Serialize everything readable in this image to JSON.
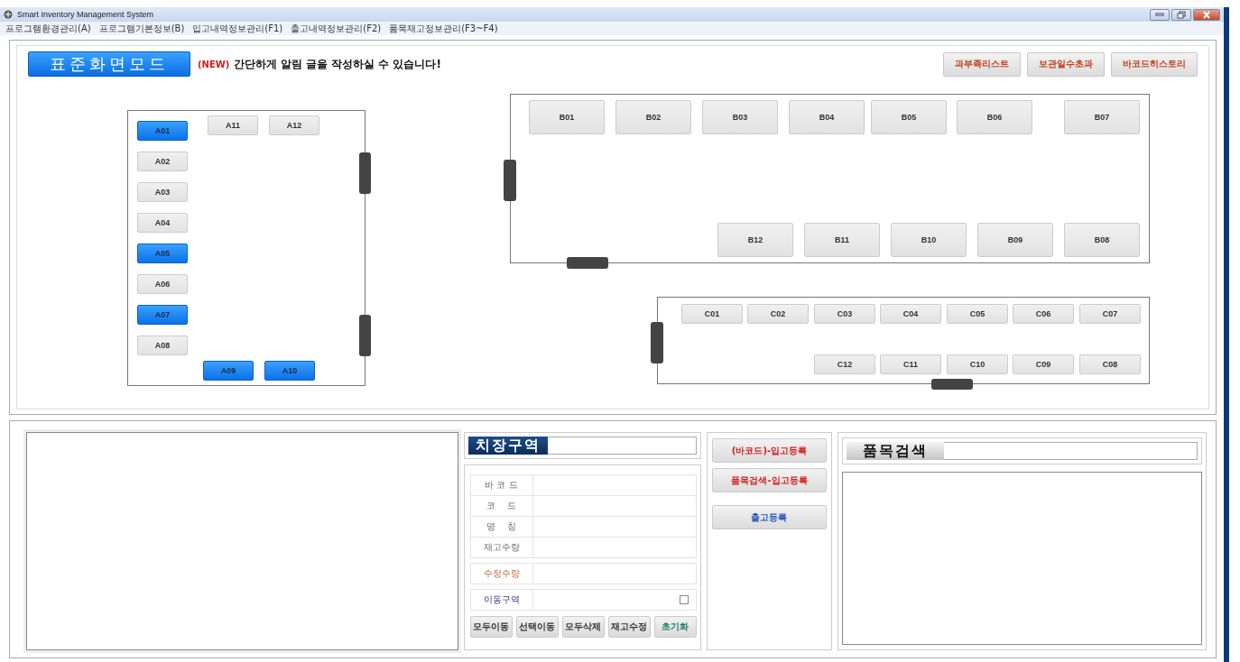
{
  "window": {
    "title": "Smart Inventory Management System"
  },
  "menu": [
    "프로그램환경관리(A)",
    "프로그램기본정보(B)",
    "입고내역정보관리(F1)",
    "출고내역정보관리(F2)",
    "품목재고정보관리(F3~F4)"
  ],
  "mode_banner": "표준화면모드",
  "notice": {
    "tag": "(NEW)",
    "text": "간단하게 알림 글을 작성하실 수 있습니다!"
  },
  "header_buttons": [
    "과부족리스트",
    "보관일수초과",
    "바코드히스토리"
  ],
  "zones": [
    {
      "slots": [
        {
          "label": "A01",
          "selected": true
        },
        {
          "label": "A02",
          "selected": false
        },
        {
          "label": "A03",
          "selected": false
        },
        {
          "label": "A04",
          "selected": false
        },
        {
          "label": "A05",
          "selected": true
        },
        {
          "label": "A06",
          "selected": false
        },
        {
          "label": "A07",
          "selected": true
        },
        {
          "label": "A08",
          "selected": false
        },
        {
          "label": "A09",
          "selected": true
        },
        {
          "label": "A10",
          "selected": true
        },
        {
          "label": "A11",
          "selected": false
        },
        {
          "label": "A12",
          "selected": false
        }
      ]
    },
    {
      "slots": [
        {
          "label": "B01",
          "selected": false
        },
        {
          "label": "B02",
          "selected": false
        },
        {
          "label": "B03",
          "selected": false
        },
        {
          "label": "B04",
          "selected": false
        },
        {
          "label": "B05",
          "selected": false
        },
        {
          "label": "B06",
          "selected": false
        },
        {
          "label": "B07",
          "selected": false
        },
        {
          "label": "B12",
          "selected": false
        },
        {
          "label": "B11",
          "selected": false
        },
        {
          "label": "B10",
          "selected": false
        },
        {
          "label": "B09",
          "selected": false
        },
        {
          "label": "B08",
          "selected": false
        }
      ]
    },
    {
      "slots": [
        {
          "label": "C01",
          "selected": false
        },
        {
          "label": "C02",
          "selected": false
        },
        {
          "label": "C03",
          "selected": false
        },
        {
          "label": "C04",
          "selected": false
        },
        {
          "label": "C05",
          "selected": false
        },
        {
          "label": "C06",
          "selected": false
        },
        {
          "label": "C07",
          "selected": false
        },
        {
          "label": "C12",
          "selected": false
        },
        {
          "label": "C11",
          "selected": false
        },
        {
          "label": "C10",
          "selected": false
        },
        {
          "label": "C09",
          "selected": false
        },
        {
          "label": "C08",
          "selected": false
        }
      ]
    }
  ],
  "storage_zone": {
    "title": "치장구역",
    "fields": [
      {
        "label": "바 코 드",
        "kind": "info"
      },
      {
        "label": "코    드",
        "kind": "info"
      },
      {
        "label": "명    칭",
        "kind": "info"
      },
      {
        "label": "재고수량",
        "kind": "info"
      },
      {
        "label": "수정수량",
        "kind": "edit"
      }
    ],
    "move_zone": {
      "label": "이동구역",
      "checked": false
    },
    "buttons": [
      {
        "label": "모두이동",
        "kind": "normal"
      },
      {
        "label": "선택이동",
        "kind": "normal"
      },
      {
        "label": "모두삭제",
        "kind": "normal"
      },
      {
        "label": "재고수정",
        "kind": "normal"
      },
      {
        "label": "초기화",
        "kind": "reset"
      }
    ]
  },
  "register_buttons": [
    {
      "label": "(바코드)-입고등록",
      "kind": "inbound"
    },
    {
      "label": "품목검색-입고등록",
      "kind": "inbound"
    },
    {
      "label": "출고등록",
      "kind": "outbound"
    }
  ],
  "item_search": {
    "title": "품목검색"
  }
}
